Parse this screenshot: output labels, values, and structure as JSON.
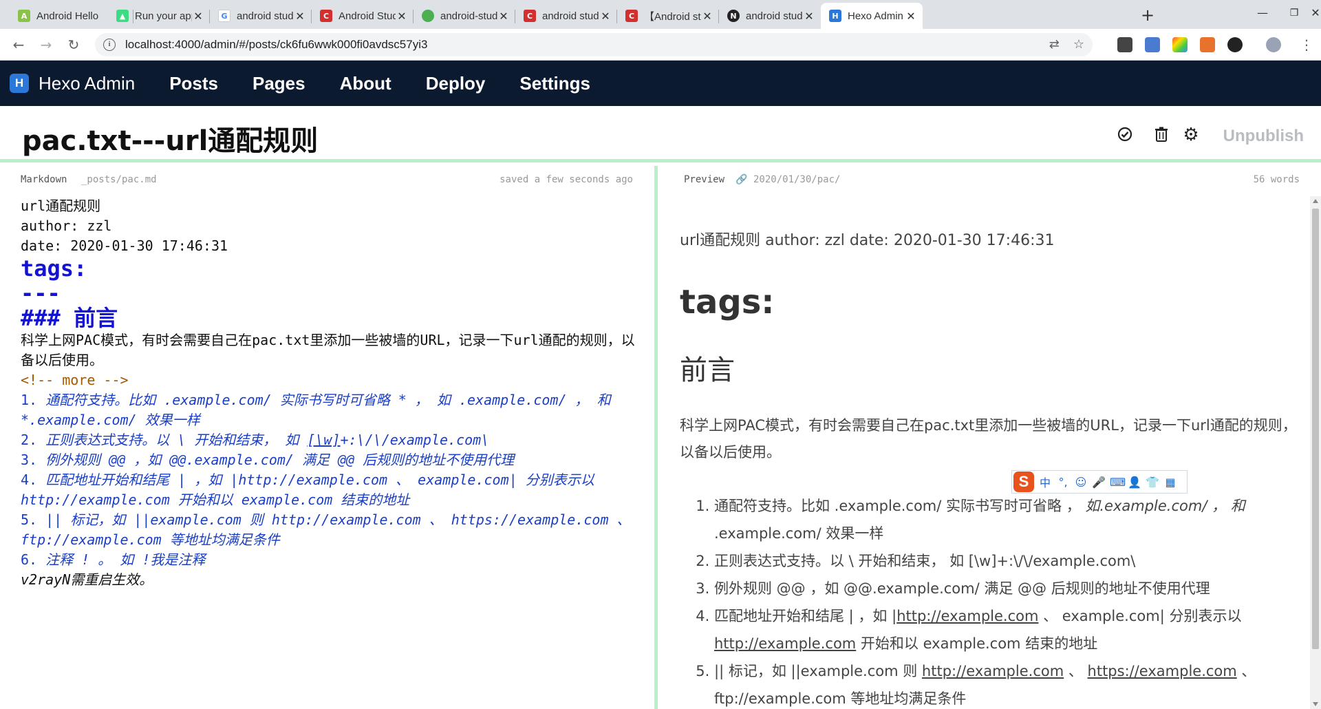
{
  "browser": {
    "tabs": [
      {
        "label": "Android Hello",
        "favicon_color": "#8bc34a",
        "favicon_glyph": "A"
      },
      {
        "label": "Run your app",
        "favicon_color": "#3ddc84",
        "favicon_glyph": "▲"
      },
      {
        "label": "android studio",
        "favicon_color": "#4285f4",
        "favicon_glyph": "G"
      },
      {
        "label": "Android Studi",
        "favicon_color": "#d32f2f",
        "favicon_glyph": "C"
      },
      {
        "label": "android-studio",
        "favicon_color": "#4caf50",
        "favicon_glyph": "●"
      },
      {
        "label": "android studio",
        "favicon_color": "#d32f2f",
        "favicon_glyph": "C"
      },
      {
        "label": "【Android stu",
        "favicon_color": "#d32f2f",
        "favicon_glyph": "C"
      },
      {
        "label": "android studio",
        "favicon_color": "#222222",
        "favicon_glyph": "N"
      },
      {
        "label": "Hexo Admin",
        "favicon_color": "#2b78d8",
        "favicon_glyph": "H"
      }
    ],
    "url": "localhost:4000/admin/#/posts/ck6fu6wwk000fi0avdsc57yi3"
  },
  "navbar": {
    "brand": "Hexo Admin",
    "links": [
      "Posts",
      "Pages",
      "About",
      "Deploy",
      "Settings"
    ]
  },
  "post": {
    "title": "pac.txt---url通配规则",
    "unpublish_label": "Unpublish"
  },
  "editor": {
    "mode_label": "Markdown",
    "file_path": "_posts/pac.md",
    "save_status": "saved a few seconds ago",
    "lines": {
      "l1": "url通配规则",
      "l2": "author: zzl",
      "l3": "date: 2020-01-30 17:46:31",
      "l4": "tags:",
      "l5": "---",
      "l6": "### 前言",
      "l7": "科学上网PAC模式，有时会需要自己在pac.txt里添加一些被墙的URL，记录一下url通配的规则，以备以后使用。",
      "l8": "<!-- more -->",
      "l9a": "1.",
      "l9b": " 通配符支持。比如 .example.com/ 实际书写时可省略 * ， 如 .example.com/ ， 和 *.example.com/ 效果一样",
      "l10a": "2.",
      "l10b": " 正则表达式支持。以 \\ 开始和结束， 如 ",
      "l10c": "[\\w]",
      "l10d": "+:\\/\\/example.com\\",
      "l11a": "3.",
      "l11b": " 例外规则 @@ ，如 @@.example.com/ 满足 @@ 后规则的地址不使用代理",
      "l12a": "4.",
      "l12b": " 匹配地址开始和结尾 | ，如 |http://example.com 、 example.com| 分别表示以 http://example.com 开始和以 example.com 结束的地址",
      "l13a": "5.",
      "l13b": " || 标记，如 ||example.com 则 http://example.com 、 https://example.com 、 ftp://example.com 等地址均满足条件",
      "l14a": "6.",
      "l14b": " 注释 ! 。 如 !我是注释",
      "l15": "v2rayN需重启生效。"
    }
  },
  "preview": {
    "label": "Preview",
    "permalink": "2020/01/30/pac/",
    "word_count": "56 words",
    "meta_line": "url通配规则 author: zzl date: 2020-01-30 17:46:31",
    "h1": "tags:",
    "h3": "前言",
    "paragraph": "科学上网PAC模式，有时会需要自己在pac.txt里添加一些被墙的URL，记录一下url通配的规则，以备以后使用。",
    "list": {
      "i1a": "通配符支持。比如 .example.com/ 实际书写时可省略 ，",
      "i1b": " 如.example.com/ ， 和",
      "i1c": " .example.com/ 效果一样",
      "i2": "正则表达式支持。以 \\ 开始和结束， 如 [\\w]+:\\/\\/example.com\\",
      "i3": "例外规则 @@ ，如 @@.example.com/ 满足 @@ 后规则的地址不使用代理",
      "i4a": "匹配地址开始和结尾 | ，如 |",
      "i4b": "http://example.com",
      "i4c": " 、 example.com| 分别表示以 ",
      "i4d": "http://example.com",
      "i4e": " 开始和以 example.com 结束的地址",
      "i5a": "|| 标记，如 ||example.com 则 ",
      "i5b": "http://example.com",
      "i5c": " 、 ",
      "i5d": "https://example.com",
      "i5e": " 、 ftp://example.com 等地址均满足条件"
    }
  },
  "ime": {
    "logo": "S",
    "items": [
      "中",
      "°,",
      "☺",
      "🎤",
      "⌨",
      "👤",
      "👕",
      "▦"
    ]
  }
}
